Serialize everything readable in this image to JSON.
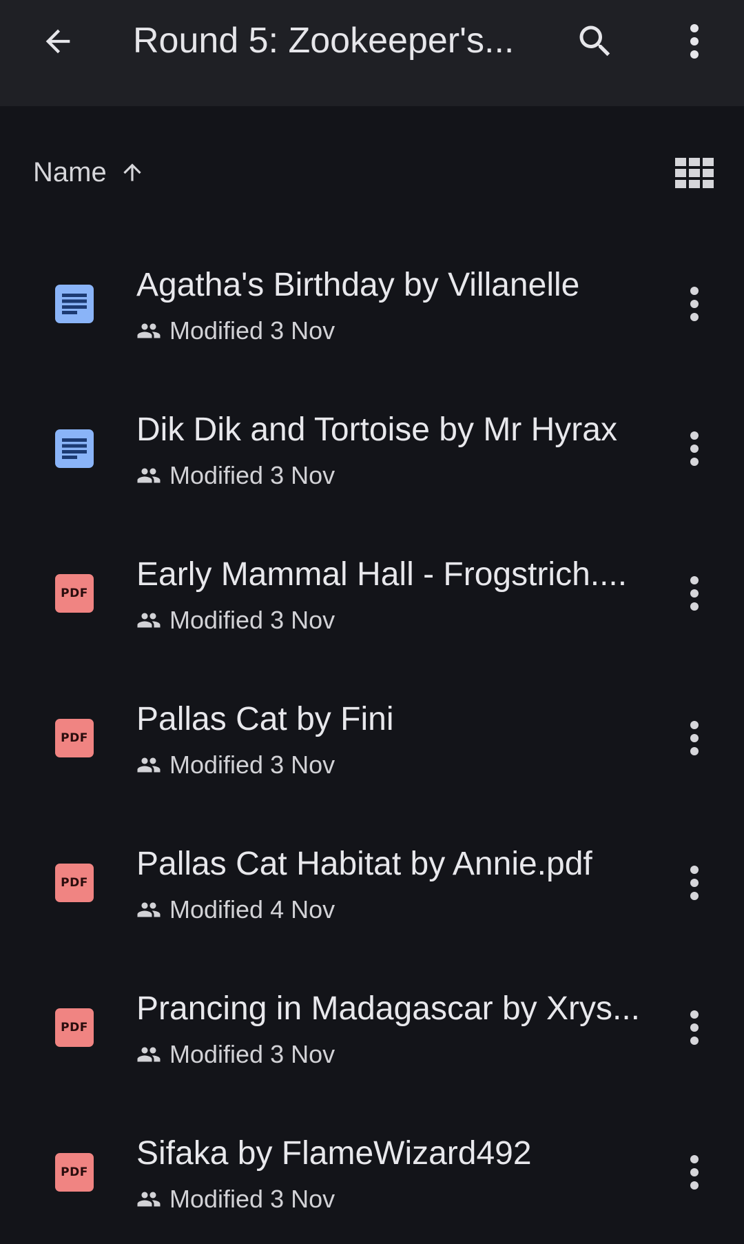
{
  "appbar": {
    "title": "Round 5: Zookeeper's...",
    "back_icon": "arrow-left-icon",
    "search_icon": "search-icon",
    "more_icon": "more-vert-icon"
  },
  "sort": {
    "label": "Name",
    "direction_icon": "arrow-up-icon",
    "view_toggle_icon": "grid-view-icon"
  },
  "colors": {
    "background": "#131419",
    "appbar": "#1f2025",
    "doc_icon": "#8ab4f8",
    "pdf_icon": "#f08482"
  },
  "files": [
    {
      "name": "Agatha's Birthday by Villanelle",
      "type": "doc",
      "modified": "Modified 3 Nov"
    },
    {
      "name": "Dik Dik and Tortoise by Mr Hyrax",
      "type": "doc",
      "modified": "Modified 3 Nov"
    },
    {
      "name": "Early Mammal Hall - Frogstrich....",
      "type": "pdf",
      "modified": "Modified 3 Nov"
    },
    {
      "name": "Pallas Cat by Fini",
      "type": "pdf",
      "modified": "Modified 3 Nov"
    },
    {
      "name": "Pallas Cat Habitat by Annie.pdf",
      "type": "pdf",
      "modified": "Modified 4 Nov"
    },
    {
      "name": "Prancing in Madagascar by Xrys...",
      "type": "pdf",
      "modified": "Modified 3 Nov"
    },
    {
      "name": "Sifaka by FlameWizard492",
      "type": "pdf",
      "modified": "Modified 3 Nov"
    }
  ],
  "pdf_icon_label": "PDF"
}
